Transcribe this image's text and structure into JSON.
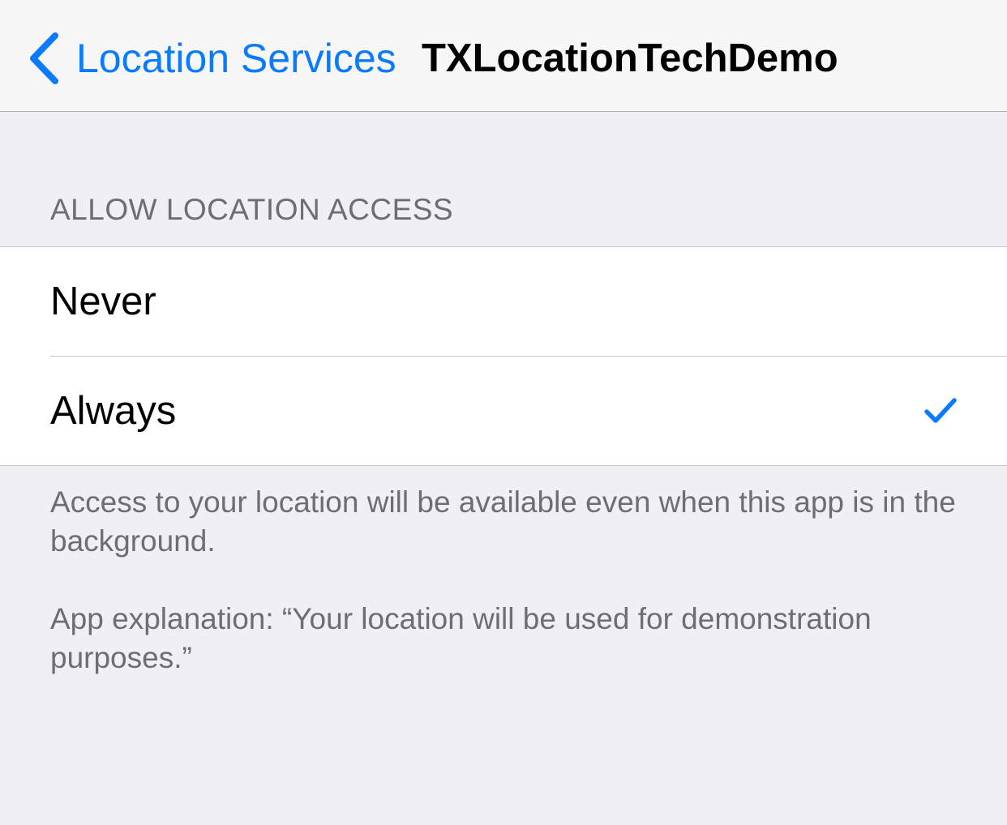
{
  "navbar": {
    "back_label": "Location Services",
    "title": "TXLocationTechDemo"
  },
  "section": {
    "header": "ALLOW LOCATION ACCESS",
    "options": [
      {
        "label": "Never",
        "selected": false
      },
      {
        "label": "Always",
        "selected": true
      }
    ]
  },
  "footer": {
    "description": "Access to your location will be available even when this app is in the background.",
    "explanation": "App explanation: “Your location will be used for demonstration purposes.”"
  },
  "colors": {
    "accent": "#0a7aff",
    "background": "#efeff4",
    "secondary_text": "#6d6d72"
  },
  "icons": {
    "back": "chevron-left-icon",
    "selected": "checkmark-icon"
  }
}
